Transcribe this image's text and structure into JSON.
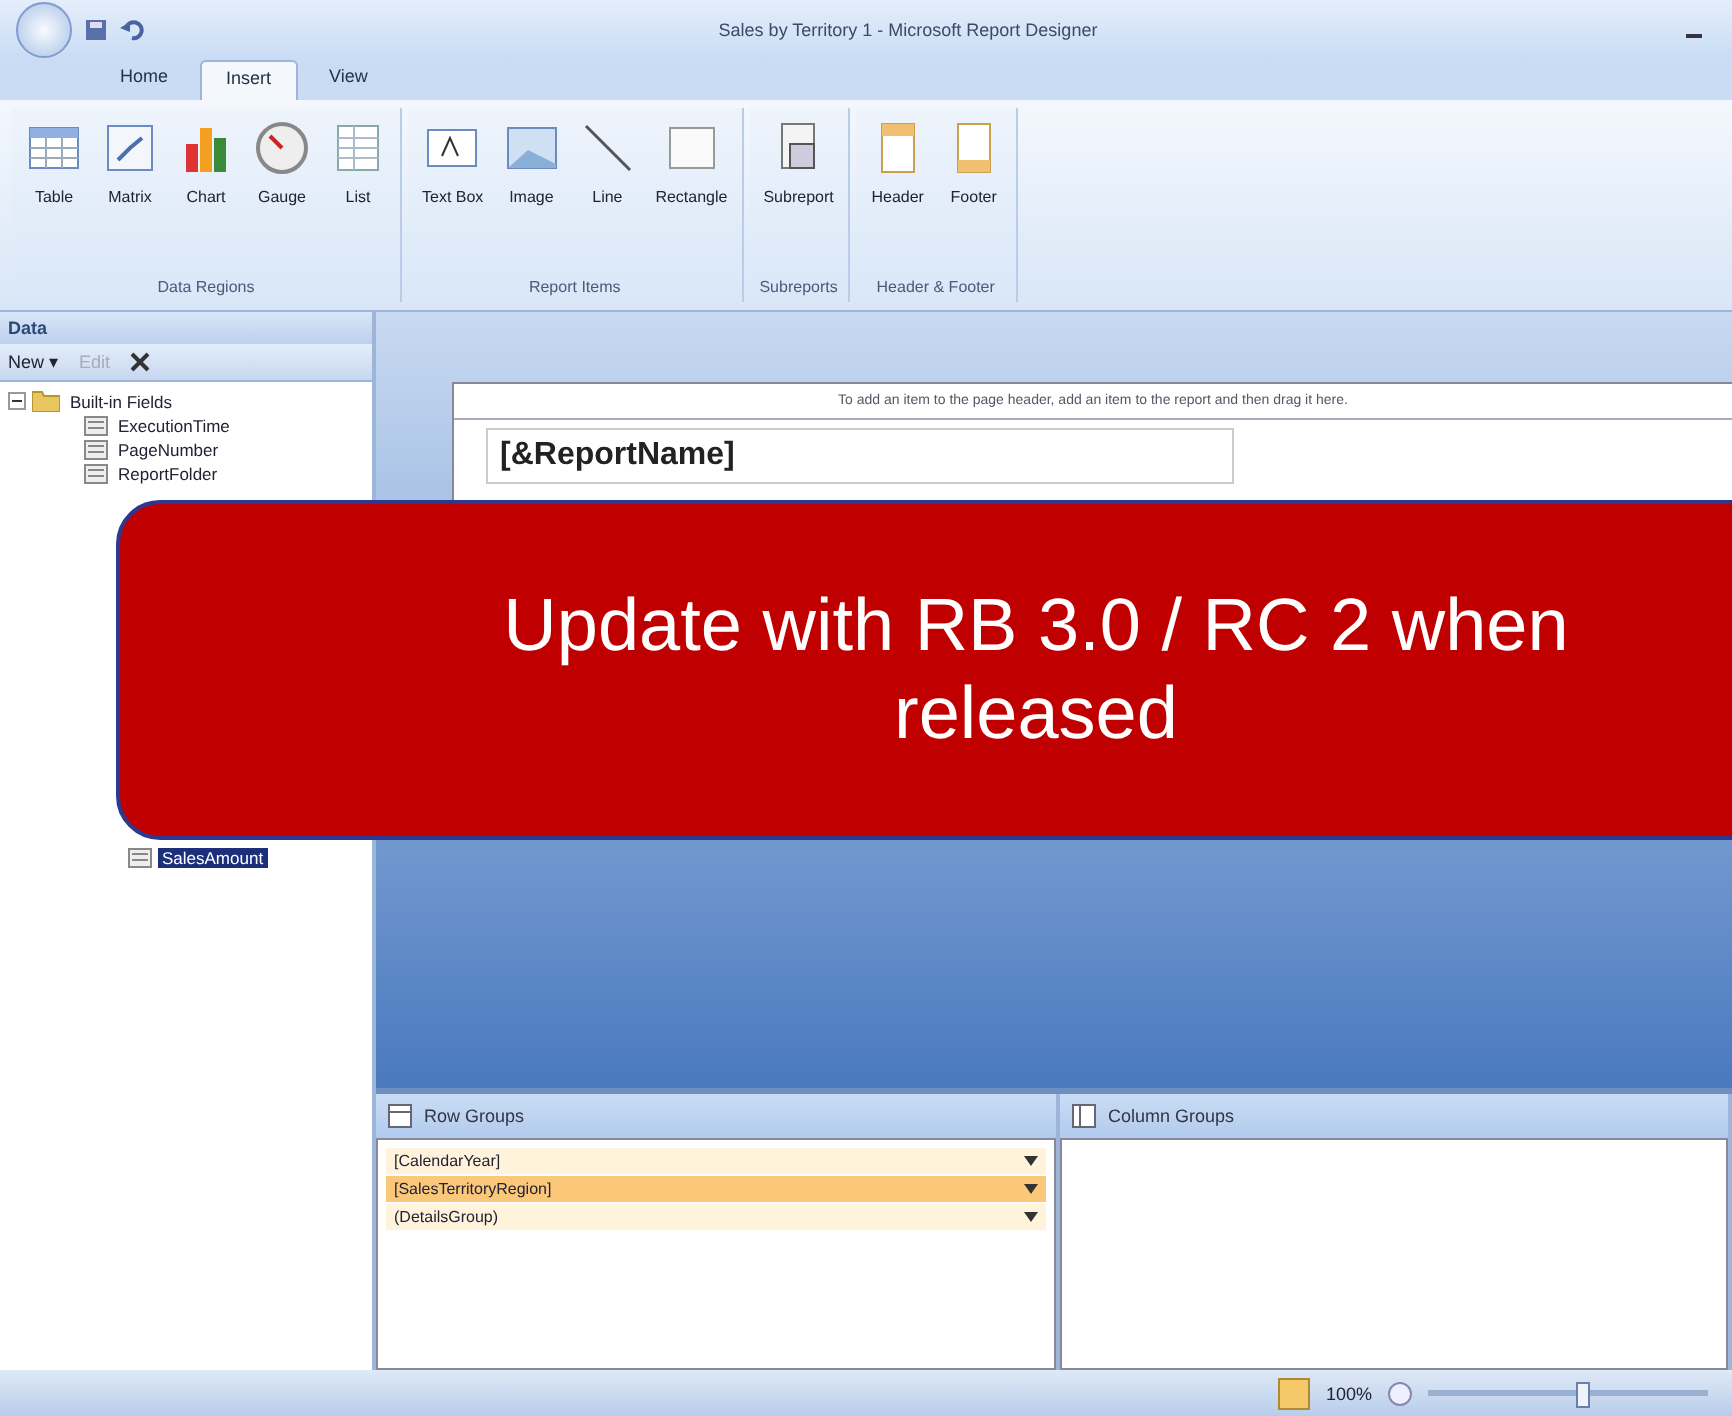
{
  "window": {
    "title": "Sales by Territory 1 - Microsoft Report Designer"
  },
  "tabs": [
    {
      "label": "Home",
      "selected": false
    },
    {
      "label": "Insert",
      "selected": true
    },
    {
      "label": "View",
      "selected": false
    }
  ],
  "ribbon_groups": [
    {
      "label": "Data Regions",
      "items": [
        {
          "label": "Table",
          "kind": "table"
        },
        {
          "label": "Matrix",
          "kind": "matrix"
        },
        {
          "label": "Chart",
          "kind": "chart"
        },
        {
          "label": "Gauge",
          "kind": "gauge"
        },
        {
          "label": "List",
          "kind": "list"
        }
      ]
    },
    {
      "label": "Report Items",
      "items": [
        {
          "label": "Text Box",
          "kind": "textbox"
        },
        {
          "label": "Image",
          "kind": "image"
        },
        {
          "label": "Line",
          "kind": "line"
        },
        {
          "label": "Rectangle",
          "kind": "rectangle"
        }
      ]
    },
    {
      "label": "Subreports",
      "items": [
        {
          "label": "Subreport",
          "kind": "subreport"
        }
      ]
    },
    {
      "label": "Header & Footer",
      "items": [
        {
          "label": "Header",
          "kind": "header"
        },
        {
          "label": "Footer",
          "kind": "footer"
        }
      ]
    }
  ],
  "data_pane": {
    "title": "Data",
    "toolbar": [
      {
        "label": "New ▾",
        "disabled": false
      },
      {
        "label": "Edit",
        "disabled": true
      }
    ],
    "tree": [
      {
        "label": "Built-in Fields",
        "expanded": true,
        "children": [
          {
            "label": "ExecutionTime",
            "selected": false
          },
          {
            "label": "PageNumber",
            "selected": false
          },
          {
            "label": "ReportFolder",
            "selected": false
          }
        ]
      }
    ],
    "tree_tail": [
      {
        "label": "SalesAmount",
        "selected": true
      }
    ]
  },
  "report": {
    "header_hint": "To add an item to the page header, add an item to the report and then drag it here.",
    "name_box": "[&ReportName]"
  },
  "callout": {
    "text": "Update with RB 3.0 / RC 2 when released"
  },
  "row_groups": {
    "title": "Row Groups",
    "items": [
      {
        "label": "[CalendarYear]",
        "selected": false
      },
      {
        "label": "[SalesTerritoryRegion]",
        "selected": true
      },
      {
        "label": "(DetailsGroup)",
        "selected": false
      }
    ]
  },
  "column_groups": {
    "title": "Column Groups"
  },
  "status_bar": {
    "zoom": "100%",
    "zoom_slider": {
      "level": 0.55
    }
  }
}
